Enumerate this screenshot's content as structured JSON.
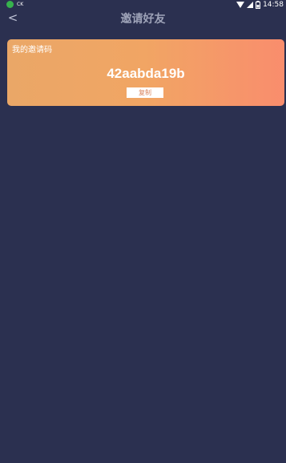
{
  "status_bar": {
    "carrier": "CK",
    "time": "14:58",
    "icons": [
      "app-notification-icon",
      "wifi-icon",
      "cell-signal-icon",
      "battery-icon"
    ]
  },
  "nav": {
    "back_icon": "<",
    "title": "邀请好友"
  },
  "invite_card": {
    "label": "我的邀请码",
    "code": "42aabda19b",
    "copy_label": "复制"
  },
  "colors": {
    "background": "#2b3050",
    "card_gradient_start": "#eaa767",
    "card_gradient_end": "#f98d6d",
    "copy_text": "#d9825a"
  }
}
